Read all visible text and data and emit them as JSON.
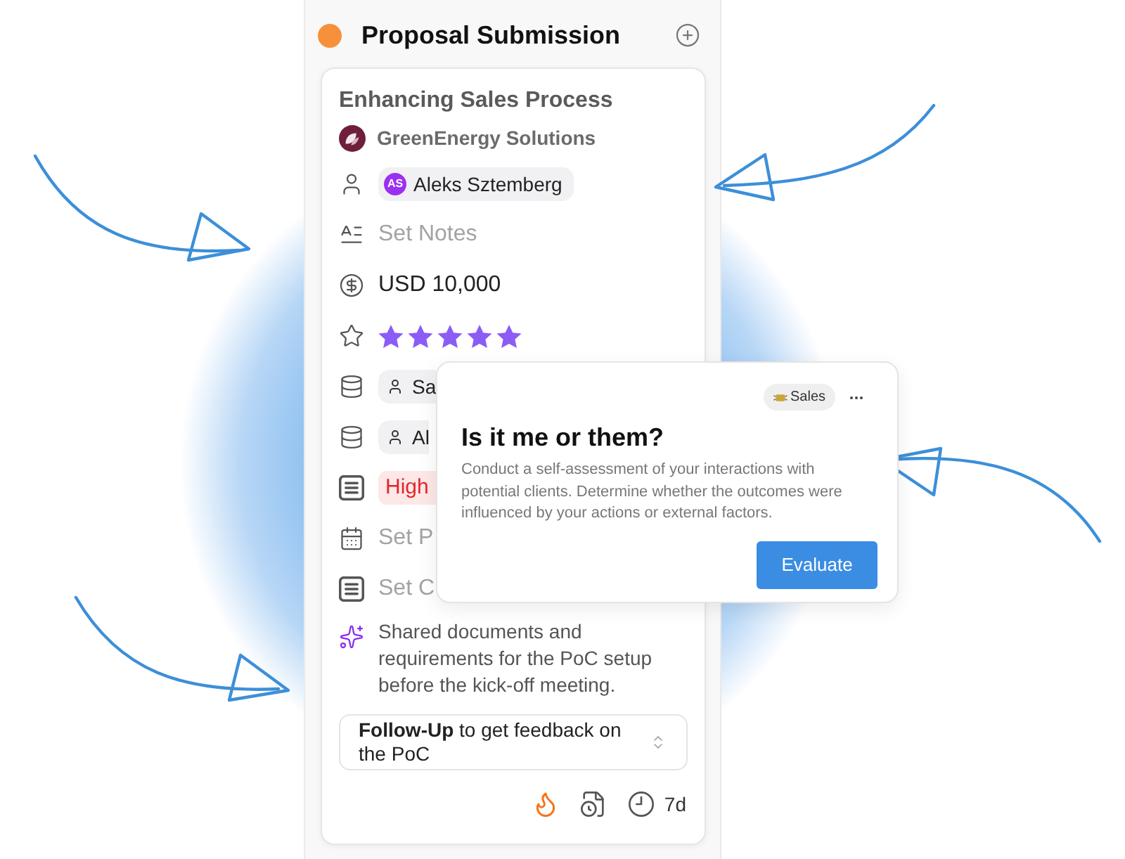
{
  "column": {
    "title": "Proposal Submission"
  },
  "card": {
    "title": "Enhancing Sales Process",
    "company": "GreenEnergy Solutions",
    "fields": [
      {
        "kind": "person",
        "initials": "AS",
        "name": "Aleks Sztemberg"
      },
      {
        "kind": "empty",
        "prompt": "Set Notes"
      },
      {
        "kind": "amount",
        "value": "USD 10,000"
      },
      {
        "kind": "rating",
        "stars": 5
      },
      {
        "kind": "contact",
        "name": "Sa"
      },
      {
        "kind": "contact",
        "name": "Al"
      },
      {
        "kind": "priority",
        "value": "High"
      },
      {
        "kind": "empty",
        "prompt": "Set P"
      },
      {
        "kind": "empty",
        "prompt": "Set C"
      },
      {
        "kind": "note",
        "text": "Shared documents and requirements for the PoC setup before the kick-off meeting."
      }
    ],
    "next_step": "**Follow-Up** to get feedback on the PoC",
    "due": "7d"
  },
  "popup": {
    "tag": "Sales",
    "title": "Is it me or them?",
    "description": "Conduct a self-assessment of your interactions with potential clients. Determine whether the outcomes were influenced by your actions or external factors.",
    "button": "Evaluate"
  }
}
